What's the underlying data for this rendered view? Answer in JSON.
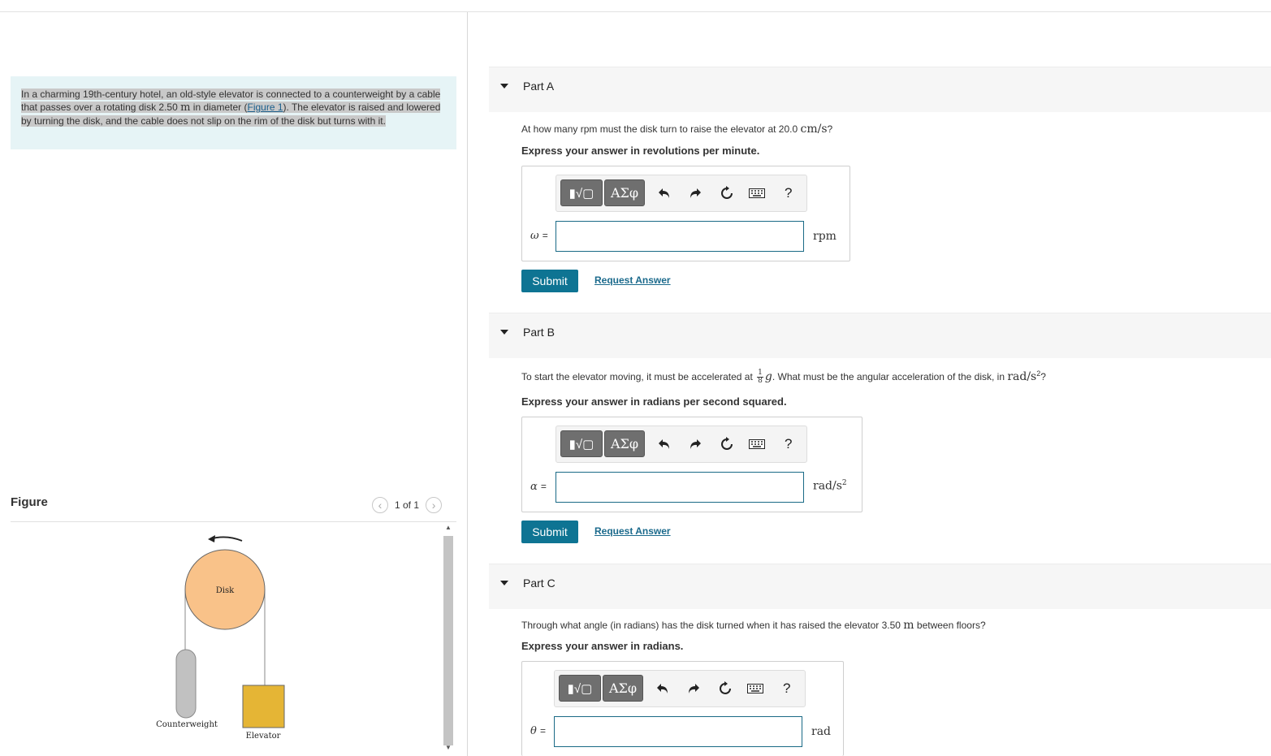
{
  "problem": {
    "text_before": "In a charming 19th-century hotel, an old-style elevator is connected to a counterweight by a cable that passes over a rotating disk 2.50 ",
    "unit_m": "m",
    "text_mid": " in diameter (",
    "figure_link": "Figure 1",
    "text_after": "). The elevator is raised and lowered by turning the disk, and the cable does not slip on the rim of the disk but turns with it."
  },
  "figure": {
    "title": "Figure",
    "counter": "1 of 1",
    "labels": {
      "disk": "Disk",
      "counterweight": "Counterweight",
      "elevator": "Elevator"
    }
  },
  "toolbar": {
    "template_label": "▮√▢",
    "symbols_label": "ΑΣφ",
    "help": "?"
  },
  "parts": [
    {
      "title": "Part A",
      "question_pre": "At how many rpm must the disk turn to raise the elevator at 20.0 ",
      "question_math": "cm/s",
      "question_post": "?",
      "instruction": "Express your answer in revolutions per minute.",
      "variable": "ω",
      "unit": "rpm",
      "submit": "Submit",
      "request": "Request Answer"
    },
    {
      "title": "Part B",
      "question_pre": "To start the elevator moving, it must be accelerated at ",
      "frac_num": "1",
      "frac_den": "8",
      "g": "g",
      "question_mid": ". What must be the angular acceleration of the disk, in ",
      "question_math": "rad/s",
      "question_post": "?",
      "instruction": "Express your answer in radians per second squared.",
      "variable": "α",
      "unit": "rad/s",
      "submit": "Submit",
      "request": "Request Answer"
    },
    {
      "title": "Part C",
      "question_pre": "Through what angle (in radians) has the disk turned when it has raised the elevator 3.50 ",
      "question_math": "m",
      "question_post": " between floors?",
      "instruction": "Express your answer in radians.",
      "variable": "θ",
      "unit": "rad"
    }
  ],
  "colors": {
    "disk": "#f9c289",
    "elevator": "#e5b535",
    "counterweight": "#c1c1c1",
    "submit": "#0e7493",
    "problem_bg": "#e6f4f6"
  }
}
